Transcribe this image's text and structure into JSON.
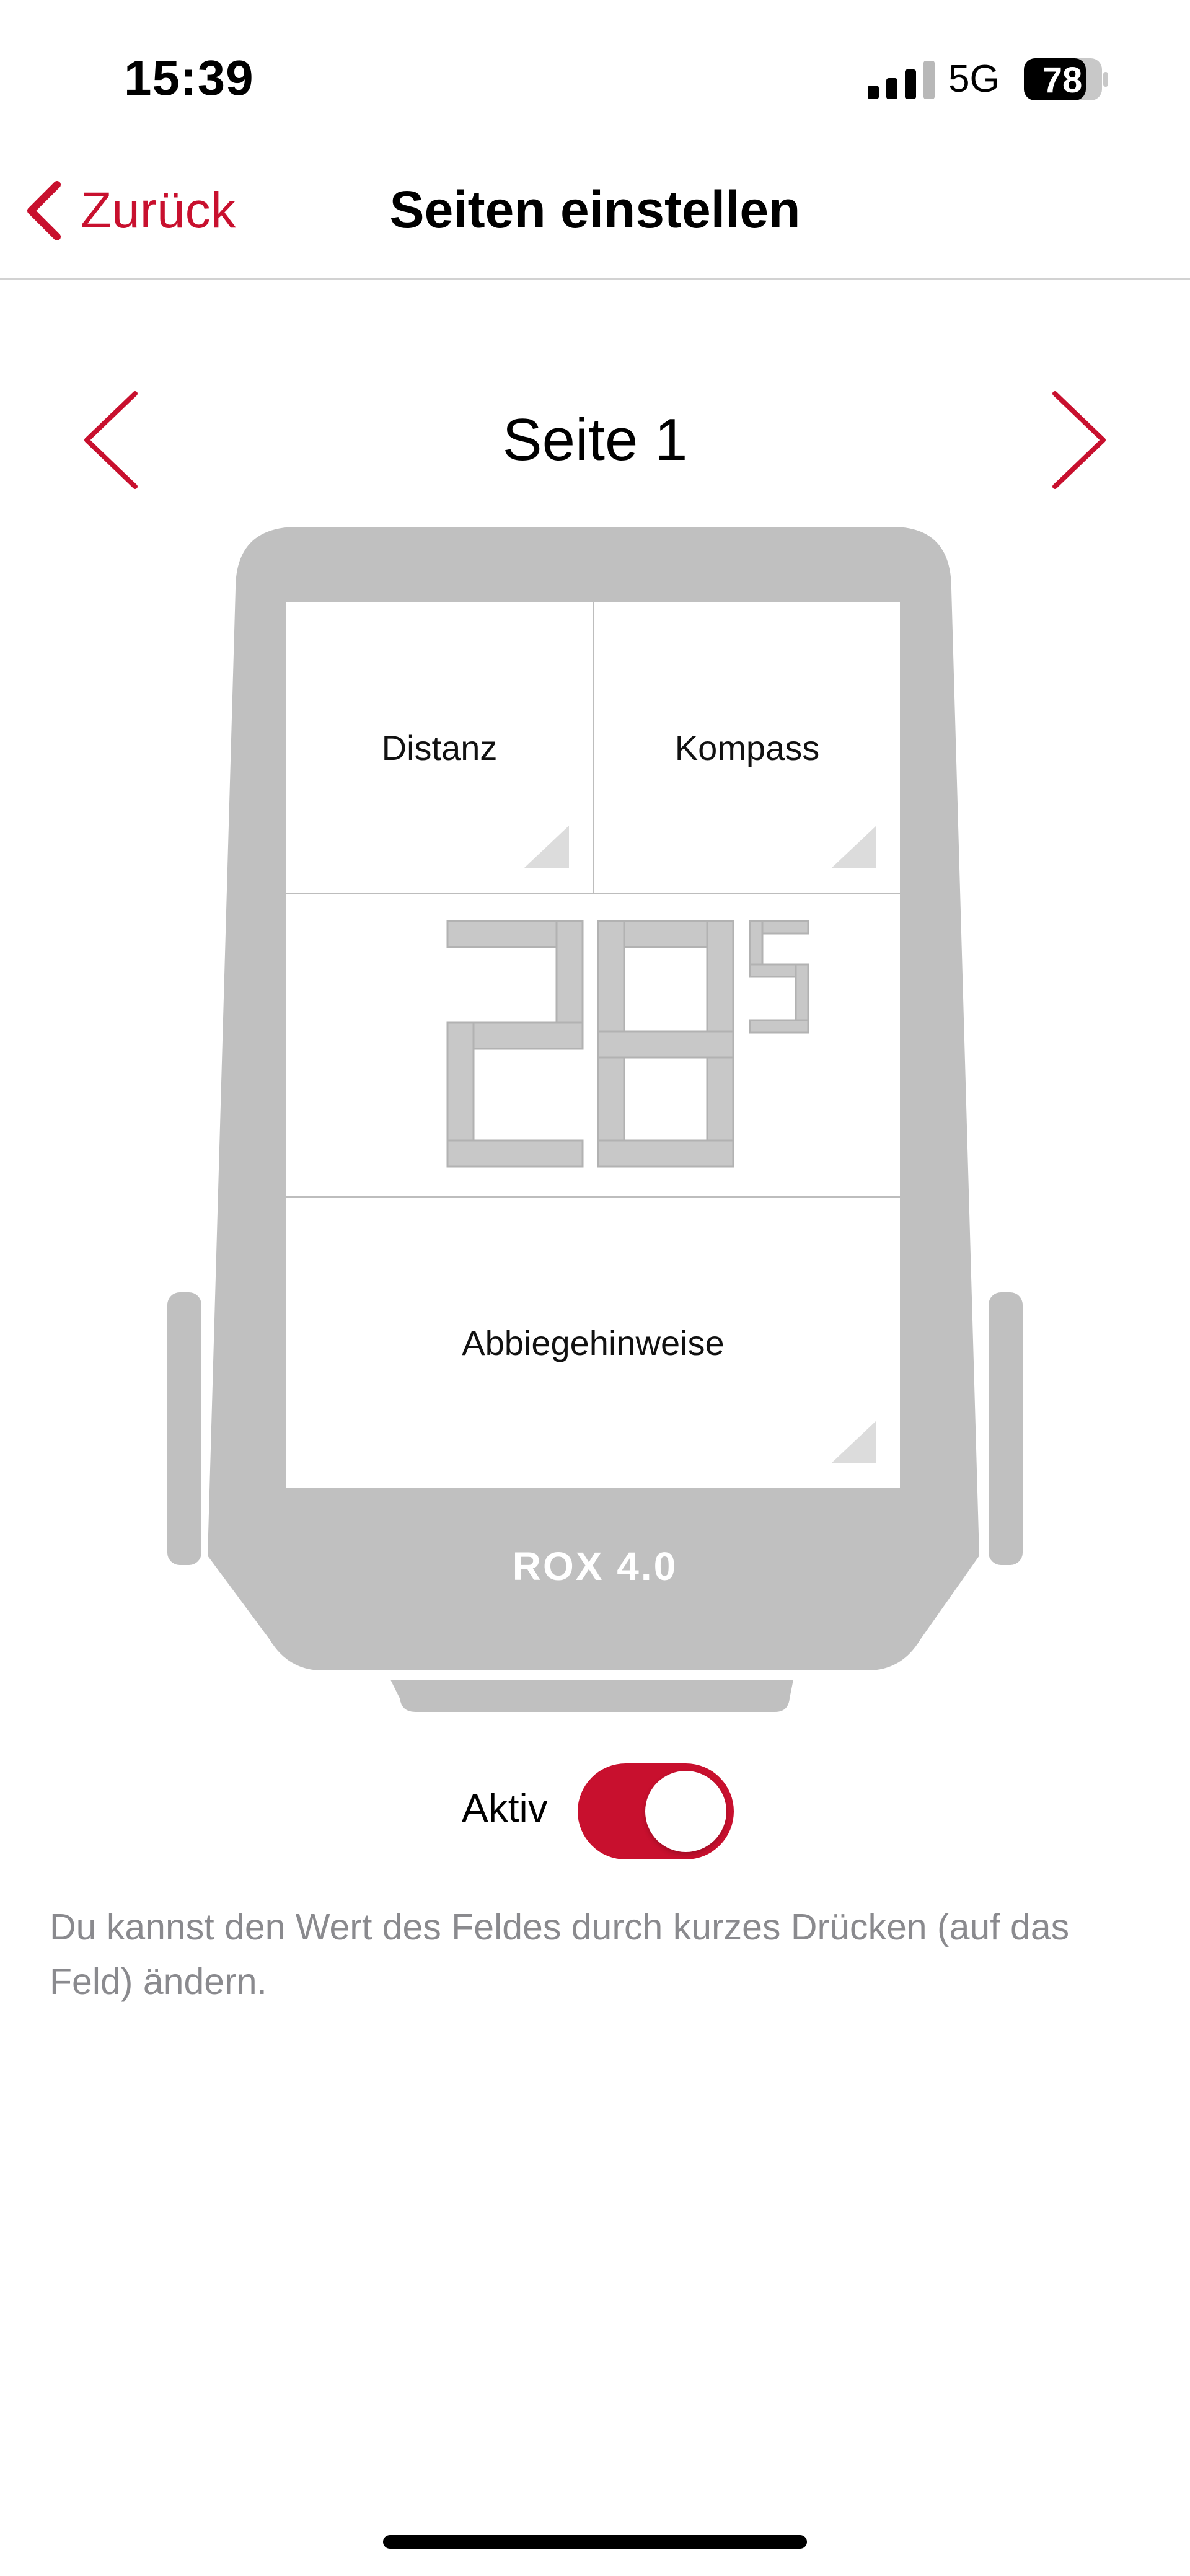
{
  "status_bar": {
    "time": "15:39",
    "network": "5G",
    "battery": "78"
  },
  "nav": {
    "back_label": "Zurück",
    "title": "Seiten einstellen"
  },
  "pager": {
    "title": "Seite 1"
  },
  "device": {
    "model": "ROX 4.0",
    "fields": {
      "top_left": "Distanz",
      "top_right": "Kompass",
      "bottom": "Abbiegehinweise"
    }
  },
  "toggle": {
    "label": "Aktiv",
    "on": true
  },
  "hint": "Du kannst den Wert des Feldes durch kurzes Drücken (auf das Feld) ändern.",
  "colors": {
    "accent": "#c8102e",
    "device": "#c0c0c0",
    "hint": "#8a8a8e"
  },
  "icons": {
    "back": "chevron-left-icon",
    "prev": "chevron-left-icon",
    "next": "chevron-right-icon",
    "signal": "cellular-signal-icon",
    "battery": "battery-icon"
  }
}
